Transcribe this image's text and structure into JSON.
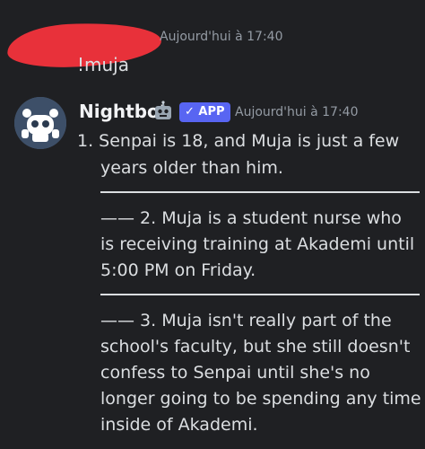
{
  "user_message": {
    "timestamp": "Aujourd'hui à 17:40",
    "text": "!muja"
  },
  "bot_message": {
    "author": "Nightbot",
    "author_icon": "robot-icon",
    "badge": "✓ APP",
    "timestamp": "Aujourd'hui à 17:40",
    "lines": [
      "1.  Senpai is 18, and Muja is just a few",
      "years older than him.",
      "—— 2. Muja is a student nurse who",
      "is receiving training at Akademi until",
      "5:00 PM on Friday.",
      "—— 3. Muja isn't really part of the",
      "school's faculty, but she still doesn't",
      "confess to Senpai until she's no",
      "longer going to be spending any time",
      "inside of Akademi."
    ]
  },
  "colors": {
    "background": "#1f2023",
    "text": "#dbdee1",
    "muted": "#949ba4",
    "badge": "#5865f2",
    "redaction": "#e8313a"
  }
}
